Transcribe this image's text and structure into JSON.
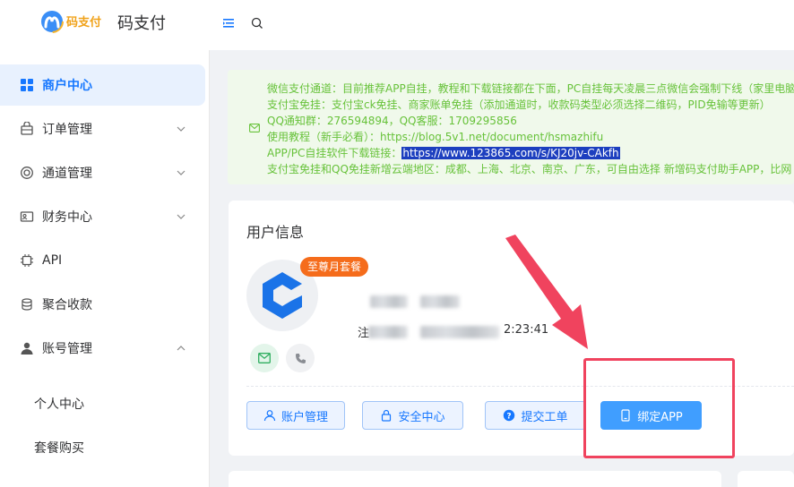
{
  "brand": {
    "title": "码支付",
    "logo_text": "码支付"
  },
  "sidebar": {
    "items": [
      {
        "label": "商户中心",
        "icon": "grid-icon",
        "active": true
      },
      {
        "label": "订单管理",
        "icon": "bag-icon",
        "chevron": "down"
      },
      {
        "label": "通道管理",
        "icon": "ring-icon",
        "chevron": "down"
      },
      {
        "label": "财务中心",
        "icon": "wallet-icon",
        "chevron": "down"
      },
      {
        "label": "API",
        "icon": "chip-icon"
      },
      {
        "label": "聚合收款",
        "icon": "coins-icon"
      },
      {
        "label": "账号管理",
        "icon": "user-icon",
        "chevron": "up"
      }
    ],
    "subitems": [
      {
        "label": "个人中心"
      },
      {
        "label": "套餐购买"
      }
    ]
  },
  "notice": {
    "lines": [
      "微信支付通道：目前推荐APP自挂，教程和下载链接都在下面，PC自挂每天凌晨三点微信会强制下线（家里电脑",
      "支付宝免挂：支付宝ck免挂、商家账单免挂（添加通道时，收款码类型必须选择二维码，PID免输等更新）",
      "QQ通知群：276594894，QQ客服：1709295856",
      "使用教程（新手必看）：https://blog.5v1.net/document/hsmazhifu",
      "支付宝免挂和QQ免挂新增云端地区：成都、上海、北京、南京、广东，可自由选择 新增码支付助手APP，比网"
    ],
    "download_label": "APP/PC自挂软件下载链接：",
    "download_link": "https://www.123865.com/s/KJ20jv-CAkfh"
  },
  "user_card": {
    "title": "用户信息",
    "badge": "至尊月套餐",
    "time_prefix": "注",
    "time_suffix": "2:23:41",
    "buttons": {
      "account": "账户管理",
      "security": "安全中心",
      "ticket": "提交工单",
      "bind_app": "绑定APP"
    }
  },
  "colors": {
    "accent": "#1677ff",
    "notice_text": "#67c23a",
    "badge": "#f56c1b",
    "highlight": "#f0435e",
    "primary_button": "#409eff"
  }
}
